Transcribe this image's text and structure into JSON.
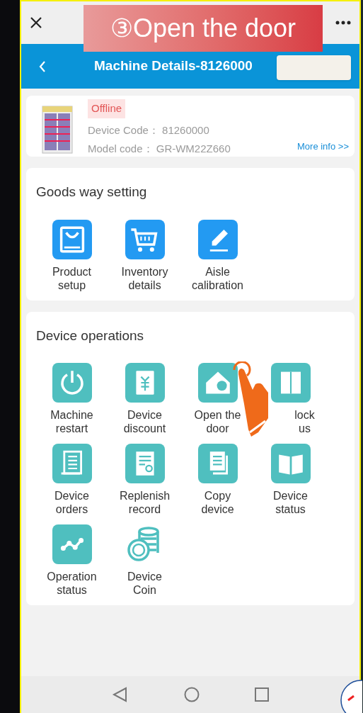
{
  "caption": "③Open the door",
  "header": {
    "title": "Machine Details-8126000"
  },
  "device": {
    "status": "Offline",
    "device_code_label": "Device Code：",
    "device_code": "81260000",
    "model_code_label": "Model code：",
    "model_code": "GR-WM22Z660",
    "more_link": "More info >>"
  },
  "sections": [
    {
      "title": "Goods way setting",
      "items": [
        {
          "label": [
            "Product",
            "setup"
          ]
        },
        {
          "label": [
            "Inventory",
            "details"
          ]
        },
        {
          "label": [
            "Aisle",
            "calibration"
          ]
        }
      ]
    },
    {
      "title": "Device operations",
      "items": [
        {
          "label": [
            "Machine",
            "restart"
          ]
        },
        {
          "label": [
            "Device",
            "discount"
          ]
        },
        {
          "label": [
            "Open the",
            "door"
          ]
        },
        {
          "label": [
            "lock",
            "us"
          ]
        },
        {
          "label": [
            "Device",
            "orders"
          ]
        },
        {
          "label": [
            "Replenish",
            "record"
          ]
        },
        {
          "label": [
            "Copy",
            "device"
          ]
        },
        {
          "label": [
            "Device",
            "status"
          ]
        },
        {
          "label": [
            "Operation",
            "status"
          ]
        },
        {
          "label": [
            "Device",
            "Coin"
          ]
        }
      ]
    }
  ]
}
